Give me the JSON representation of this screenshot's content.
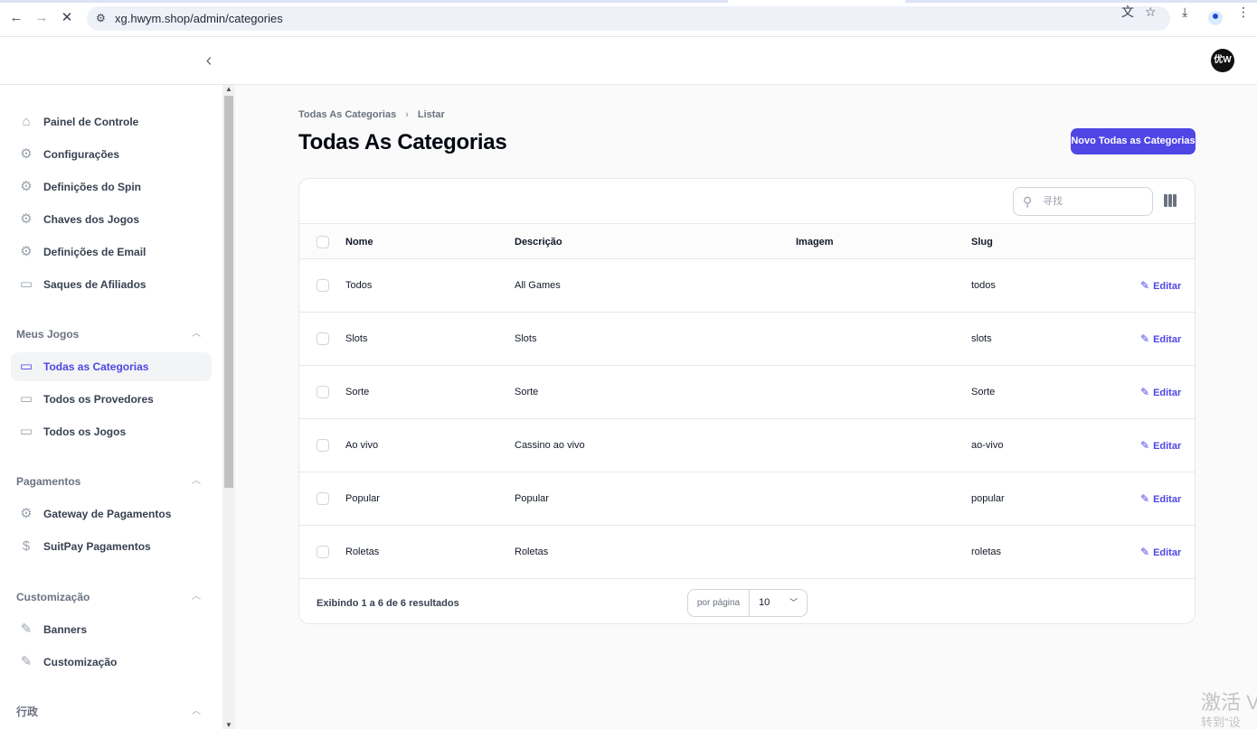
{
  "browser": {
    "url": "xg.hwym.shop/admin/categories",
    "back_icon": "arrow-left-icon",
    "forward_icon": "arrow-right-icon",
    "stop_icon": "close-icon"
  },
  "header": {
    "avatar_text": "优W"
  },
  "sidebar": {
    "items": [
      {
        "label": "Painel de Controle",
        "icon": "home-icon"
      },
      {
        "label": "Configurações",
        "icon": "gear-icon"
      },
      {
        "label": "Definições do Spin",
        "icon": "gear-icon"
      },
      {
        "label": "Chaves dos Jogos",
        "icon": "gear-icon"
      },
      {
        "label": "Definições de Email",
        "icon": "gear-icon"
      },
      {
        "label": "Saques de Afiliados",
        "icon": "cash-icon"
      }
    ],
    "groups": [
      {
        "label": "Meus Jogos",
        "items": [
          "Todas as Categorias",
          "Todos os Provedores",
          "Todos os Jogos"
        ]
      },
      {
        "label": "Pagamentos",
        "items": [
          "Gateway de Pagamentos",
          "SuitPay Pagamentos"
        ]
      },
      {
        "label": "Customização",
        "items": [
          "Banners",
          "Customização"
        ]
      },
      {
        "label": "行政"
      }
    ]
  },
  "main": {
    "breadcrumb": [
      "Todas As Categorias",
      "Listar"
    ],
    "title": "Todas As Categorias",
    "new_button": "Novo Todas as Categorias",
    "search_placeholder": "寻找",
    "columns": [
      "Nome",
      "Descrição",
      "Imagem",
      "Slug"
    ],
    "edit_label": "Editar",
    "rows": [
      {
        "nome": "Todos",
        "descricao": "All Games",
        "slug": "todos"
      },
      {
        "nome": "Slots",
        "descricao": "Slots",
        "slug": "slots"
      },
      {
        "nome": "Sorte",
        "descricao": "Sorte",
        "slug": "Sorte"
      },
      {
        "nome": "Ao vivo",
        "descricao": "Cassino ao vivo",
        "slug": "ao-vivo"
      },
      {
        "nome": "Popular",
        "descricao": "Popular",
        "slug": "popular"
      },
      {
        "nome": "Roletas",
        "descricao": "Roletas",
        "slug": "roletas"
      }
    ],
    "footer_info": "Exibindo 1 a 6 de 6 resultados",
    "per_page_label": "por página",
    "per_page_value": "10"
  },
  "watermark": {
    "line1": "激活 V",
    "line2": "转到\"设"
  },
  "colors": {
    "accent": "#4f46e5"
  }
}
